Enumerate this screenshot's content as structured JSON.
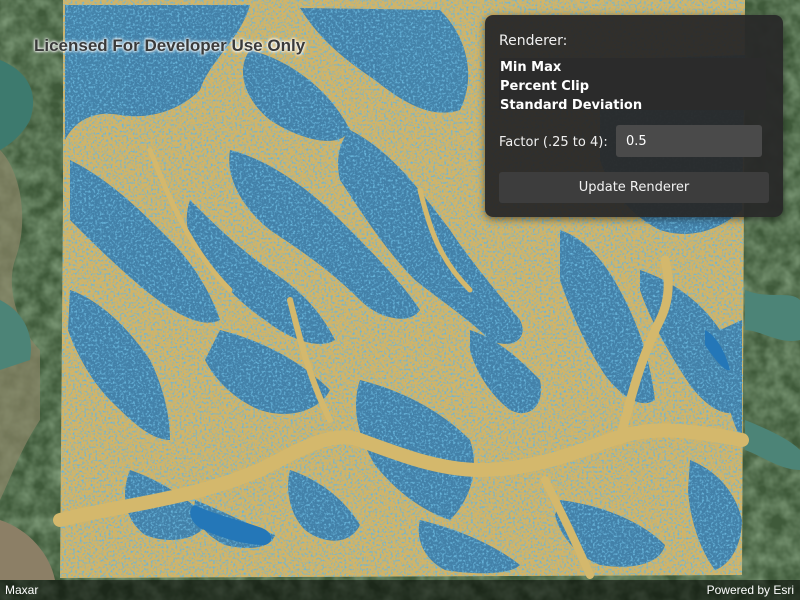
{
  "map": {
    "watermark": "Licensed For Developer Use Only",
    "attribution_left": "Maxar",
    "attribution_right": "Powered by Esri",
    "colors": {
      "raster_tan": "#d1b468",
      "raster_blue": "#2477b8",
      "basemap_green": "#3f5a3a",
      "water": "#3d7a6e"
    }
  },
  "panel": {
    "renderer_label": "Renderer:",
    "renderer_options": [
      "Min Max",
      "Percent Clip",
      "Standard Deviation"
    ],
    "factor_label": "Factor (.25 to 4):",
    "factor_value": "0.5",
    "update_button": "Update Renderer"
  }
}
